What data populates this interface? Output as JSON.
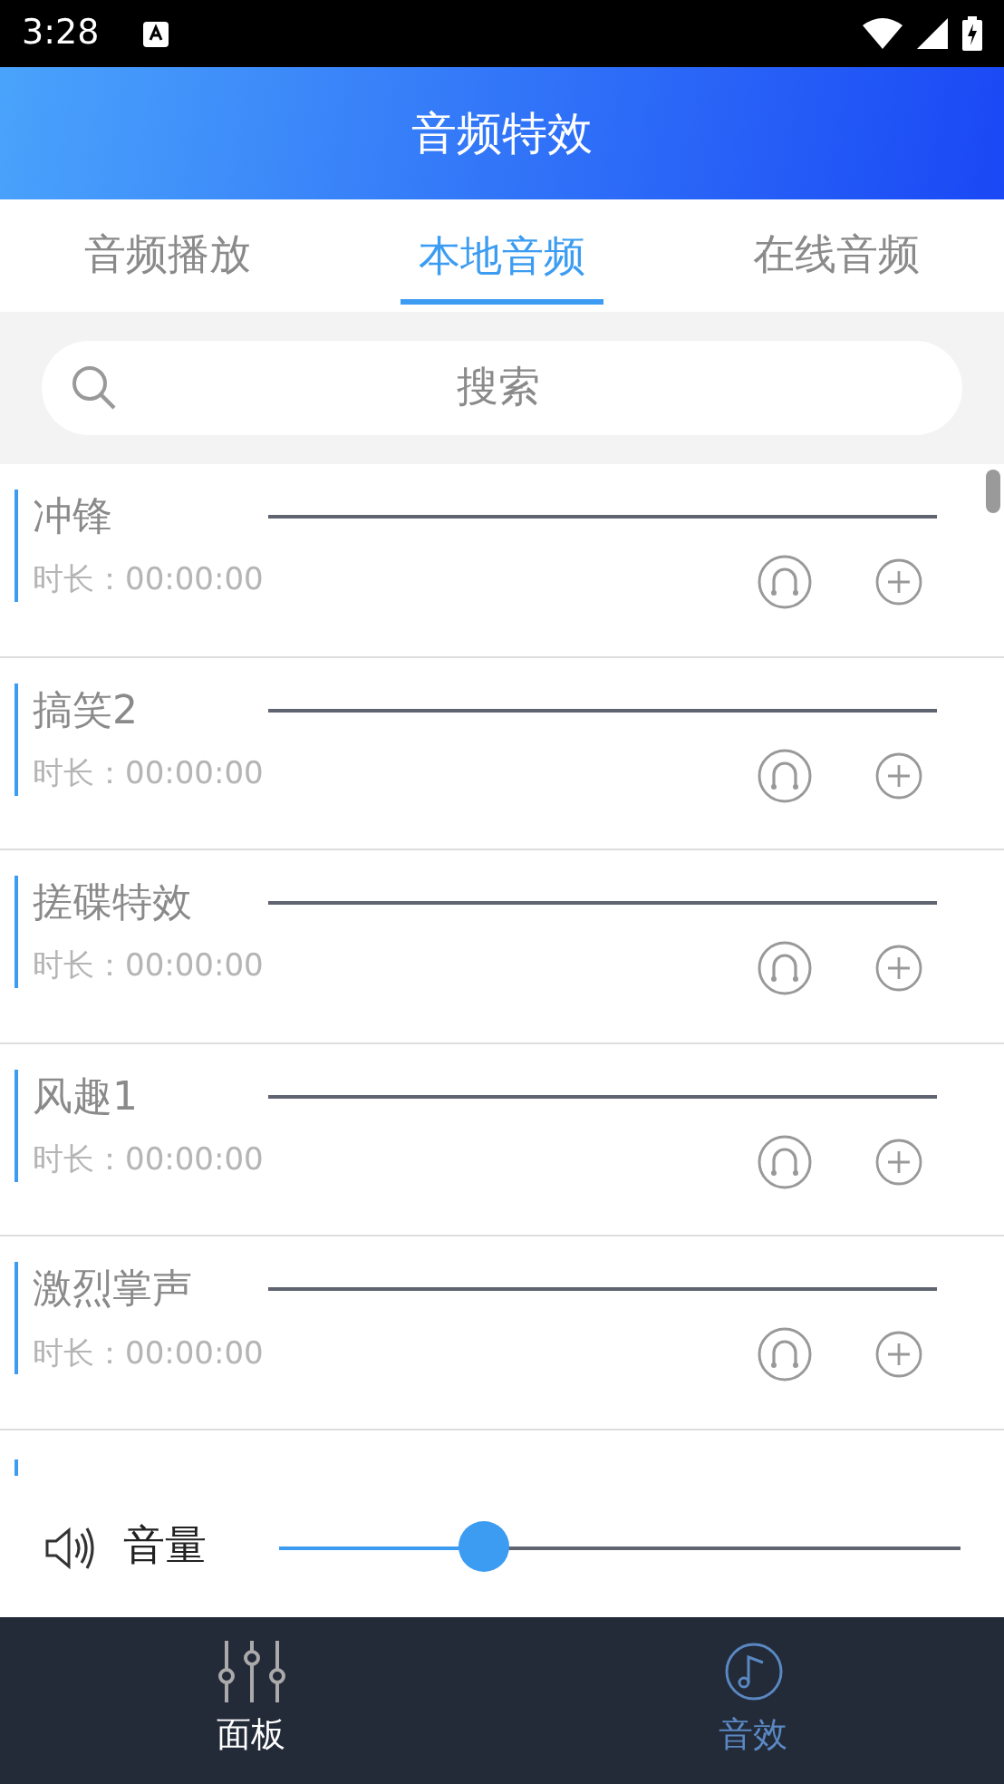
{
  "status_bar": {
    "time": "3:28"
  },
  "header": {
    "title": "音频特效"
  },
  "tabs": [
    {
      "label": "音频播放",
      "selected": false
    },
    {
      "label": "本地音频",
      "selected": true
    },
    {
      "label": "在线音频",
      "selected": false
    }
  ],
  "search": {
    "placeholder": "搜索"
  },
  "tracks": [
    {
      "name": "冲锋",
      "duration": "时长：00:00:00"
    },
    {
      "name": "搞笑2",
      "duration": "时长：00:00:00"
    },
    {
      "name": "搓碟特效",
      "duration": "时长：00:00:00"
    },
    {
      "name": "风趣1",
      "duration": "时长：00:00:00"
    },
    {
      "name": "激烈掌声",
      "duration": "时长：00:00:00"
    }
  ],
  "volume": {
    "label": "音量",
    "level": 0.3
  },
  "bottom_nav": [
    {
      "label": "面板",
      "selected": false
    },
    {
      "label": "音效",
      "selected": true
    }
  ]
}
